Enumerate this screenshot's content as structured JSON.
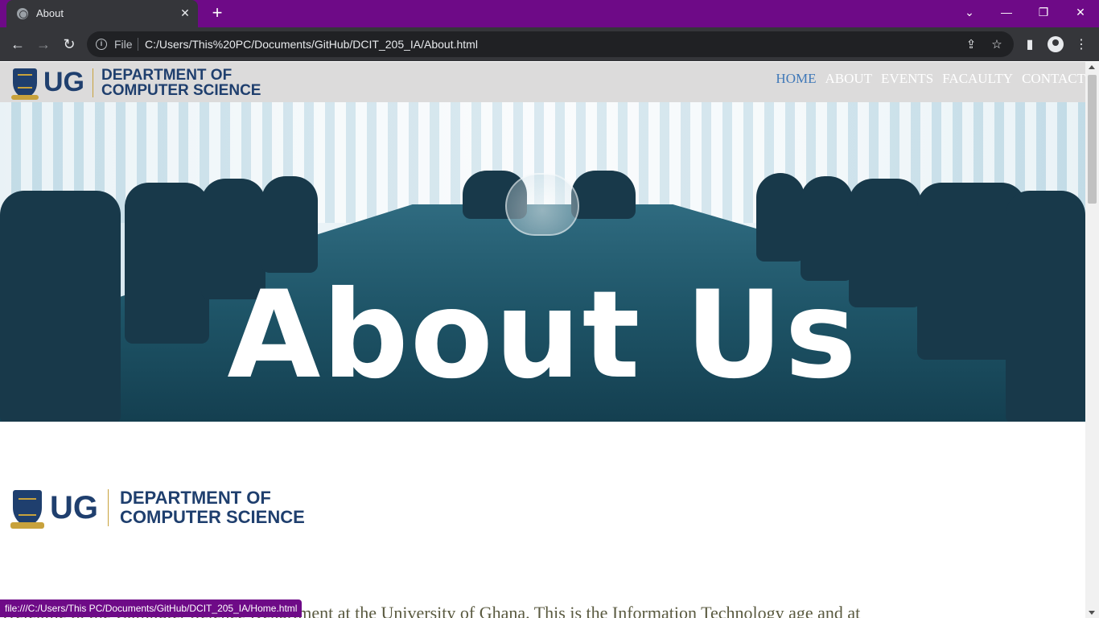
{
  "browser": {
    "tab_title": "About",
    "tab_close": "✕",
    "new_tab": "+",
    "scheme_label": "File",
    "url": "C:/Users/This%20PC/Documents/GitHub/DCIT_205_IA/About.html",
    "status_url": "file:///C:/Users/This PC/Documents/GitHub/DCIT_205_IA/Home.html",
    "window_controls": [
      "⌄",
      "—",
      "❐",
      "✕"
    ],
    "nav_glyphs": {
      "back": "←",
      "forward": "→",
      "reload": "↻"
    },
    "icons": {
      "share": "⇪",
      "star": "☆",
      "sidepanel": "▮",
      "menu": "⋮"
    }
  },
  "site": {
    "logo": {
      "ug": "UG",
      "dept_line1": "DEPARTMENT OF",
      "dept_line2": "COMPUTER SCIENCE"
    },
    "nav": [
      "HOME",
      "ABOUT",
      "EVENTS",
      "FACAULTY",
      "CONTACT"
    ],
    "active_nav": "HOME",
    "hero_title": "About Us",
    "intro_text": "Welcome to the Computer Science Department at the University of Ghana. This is the Information Technology age and at",
    "colors": {
      "brand_blue": "#1f3f6e",
      "brand_gold": "#c8a23c",
      "nav_active": "#3f78b8",
      "header_bg": "#dcdbdb",
      "tabbar": "#6e0a87"
    }
  }
}
